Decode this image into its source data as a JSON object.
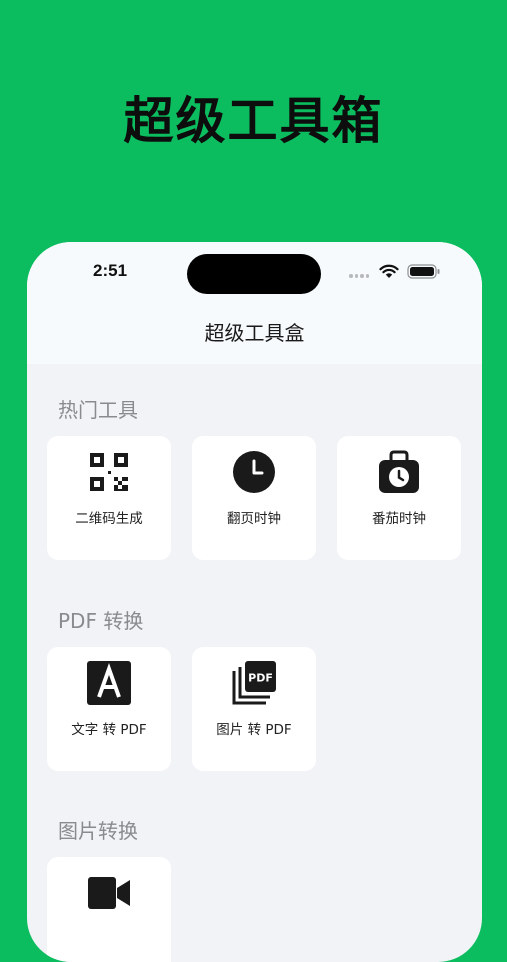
{
  "promo": {
    "headline": "超级工具箱"
  },
  "status_bar": {
    "time": "2:51",
    "icons": [
      "cellular-dots-icon",
      "wifi-icon",
      "battery-icon"
    ]
  },
  "nav": {
    "title": "超级工具盒"
  },
  "sections": [
    {
      "title": "热门工具",
      "items": [
        {
          "label": "二维码生成",
          "icon": "qr-code-icon"
        },
        {
          "label": "翻页时钟",
          "icon": "clock-icon"
        },
        {
          "label": "番茄时钟",
          "icon": "timer-bag-icon"
        }
      ]
    },
    {
      "title": "PDF 转换",
      "items": [
        {
          "label": "文字 转 PDF",
          "icon": "letter-a-icon"
        },
        {
          "label": "图片 转 PDF",
          "icon": "pdf-stack-icon"
        }
      ]
    },
    {
      "title": "图片转换",
      "items": [
        {
          "label": "",
          "icon": "video-camera-icon"
        }
      ]
    }
  ],
  "colors": {
    "background": "#0bbd5e",
    "screen": "#f2f3f7",
    "card": "#ffffff",
    "icon": "#1a1a1a"
  }
}
